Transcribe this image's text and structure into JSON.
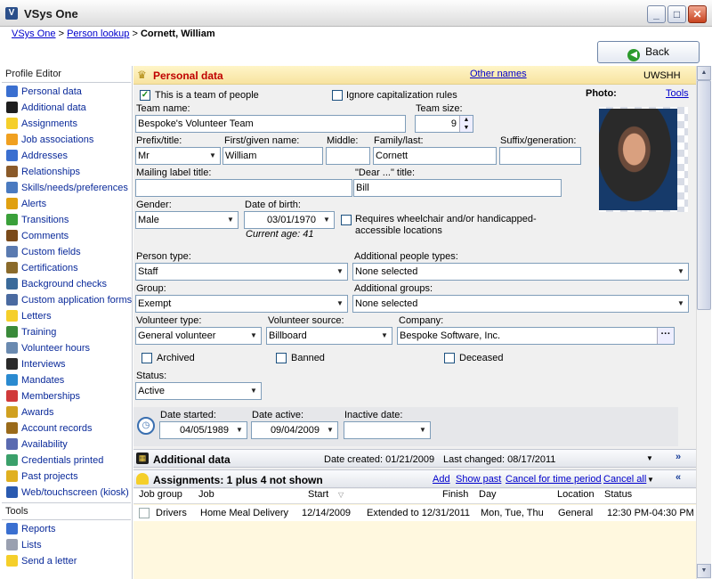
{
  "window": {
    "title": "VSys One",
    "icon": "V",
    "controls": [
      "_",
      "□",
      "✕"
    ]
  },
  "breadcrumb": {
    "root": "VSys One",
    "sep1": ">",
    "lookup": "Person lookup",
    "sep2": ">",
    "current": "Cornett, William"
  },
  "back_button": {
    "label": "Back"
  },
  "sidebar": {
    "profile_heading": "Profile Editor",
    "items": [
      "Personal data",
      "Additional data",
      "Assignments",
      "Job associations",
      "Addresses",
      "Relationships",
      "Skills/needs/preferences",
      "Alerts",
      "Transitions",
      "Comments",
      "Custom fields",
      "Certifications",
      "Background checks",
      "Custom application forms",
      "Letters",
      "Training",
      "Volunteer hours",
      "Interviews",
      "Mandates",
      "Memberships",
      "Awards",
      "Account records",
      "Availability",
      "Credentials printed",
      "Past projects",
      "Web/touchscreen (kiosk)"
    ],
    "tools_heading": "Tools",
    "tools": [
      "Reports",
      "Lists",
      "Send a letter"
    ]
  },
  "personal": {
    "title": "Personal data",
    "other_names": "Other names",
    "code": "UWSHH",
    "is_team_label": "This is a team of people",
    "ignore_caps_label": "Ignore capitalization rules",
    "team_name_label": "Team name:",
    "team_name": "Bespoke's Volunteer Team",
    "team_size_label": "Team size:",
    "team_size": "9",
    "prefix_label": "Prefix/title:",
    "prefix": "Mr",
    "first_label": "First/given name:",
    "first": "William",
    "middle_label": "Middle:",
    "middle": "",
    "last_label": "Family/last:",
    "last": "Cornett",
    "suffix_label": "Suffix/generation:",
    "suffix": "",
    "mailing_label": "Mailing label title:",
    "mailing": "",
    "dear_label": "\"Dear ...\" title:",
    "dear": "Bill",
    "gender_label": "Gender:",
    "gender": "Male",
    "dob_label": "Date of birth:",
    "dob": "03/01/1970",
    "age": "Current age: 41",
    "wheelchair_label": "Requires wheelchair and/or handicapped-accessible locations",
    "person_type_label": "Person type:",
    "person_type": "Staff",
    "addl_types_label": "Additional people types:",
    "addl_types": "None selected",
    "group_label": "Group:",
    "group": "Exempt",
    "addl_groups_label": "Additional groups:",
    "addl_groups": "None selected",
    "vol_type_label": "Volunteer type:",
    "vol_type": "General volunteer",
    "vol_source_label": "Volunteer source:",
    "vol_source": "Billboard",
    "company_label": "Company:",
    "company": "Bespoke Software, Inc.",
    "archived_label": "Archived",
    "banned_label": "Banned",
    "deceased_label": "Deceased",
    "status_label": "Status:",
    "status": "Active",
    "date_started_label": "Date started:",
    "date_started": "04/05/1989",
    "date_active_label": "Date active:",
    "date_active": "09/04/2009",
    "inactive_label": "Inactive date:",
    "inactive": "",
    "photo_label": "Photo:",
    "tools_link": "Tools"
  },
  "additional": {
    "title": "Additional data",
    "created": "Date created: 01/21/2009",
    "changed": "Last changed: 08/17/2011"
  },
  "assignments": {
    "title": "Assignments: 1 plus 4 not shown",
    "add": "Add",
    "show_past": "Show past",
    "cancel_period": "Cancel for time period",
    "cancel_all": "Cancel all",
    "columns": [
      "Job group",
      "Job",
      "Start",
      "Finish",
      "Day",
      "Location",
      "Status"
    ],
    "rows": [
      {
        "job_group": "Drivers",
        "job": "Home Meal Delivery",
        "start": "12/14/2009",
        "finish": "Extended to 12/31/2011",
        "day": "Mon, Tue, Thu",
        "location": "General",
        "status": "12:30 PM-04:30 PM"
      }
    ]
  },
  "colors": {
    "accent": "#c00000",
    "link": "#0000cc",
    "header_bg": "#f7e3a0"
  }
}
